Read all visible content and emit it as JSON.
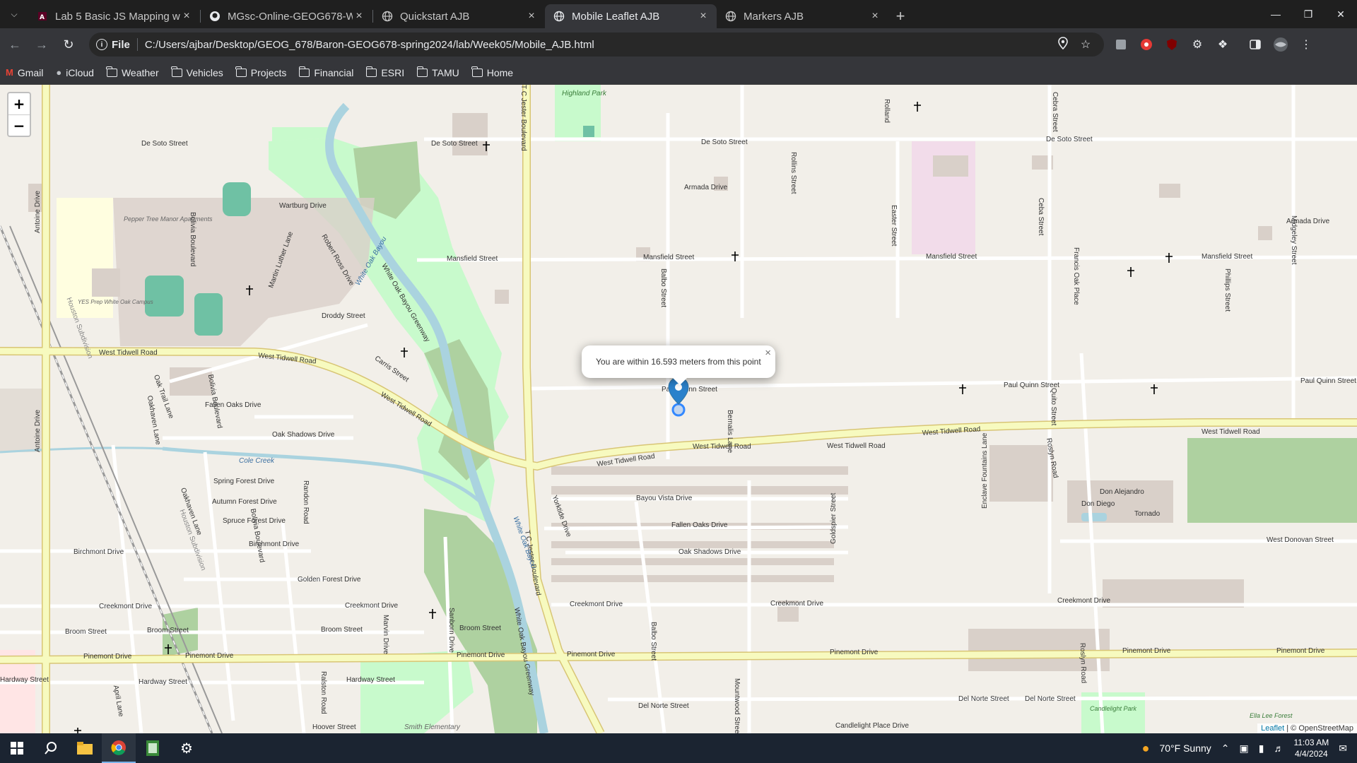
{
  "browser": {
    "tabs": [
      {
        "title": "Lab 5 Basic JS Mapping wi",
        "icon": "tamu-icon",
        "active": false
      },
      {
        "title": "MGsc-Online-GEOG678-W",
        "icon": "github-icon",
        "active": false
      },
      {
        "title": "Quickstart AJB",
        "icon": "globe-icon",
        "active": false
      },
      {
        "title": "Mobile Leaflet AJB",
        "icon": "globe-icon",
        "active": true
      },
      {
        "title": "Markers AJB",
        "icon": "globe-icon",
        "active": false
      }
    ],
    "address": {
      "scheme_label": "File",
      "url": "C:/Users/ajbar/Desktop/GEOG_678/Baron-GEOG678-spring2024/lab/Week05/Mobile_AJB.html"
    },
    "bookmarks": [
      {
        "label": "Gmail",
        "icon": "gmail-icon"
      },
      {
        "label": "iCloud",
        "icon": "apple-icon"
      },
      {
        "label": "Weather",
        "icon": "folder-icon"
      },
      {
        "label": "Vehicles",
        "icon": "folder-icon"
      },
      {
        "label": "Projects",
        "icon": "folder-icon"
      },
      {
        "label": "Financial",
        "icon": "folder-icon"
      },
      {
        "label": "ESRI",
        "icon": "folder-icon"
      },
      {
        "label": "TAMU",
        "icon": "folder-icon"
      },
      {
        "label": "Home",
        "icon": "folder-icon"
      }
    ]
  },
  "map": {
    "zoom_in": "+",
    "zoom_out": "−",
    "popup_text": "You are within 16.593 meters from this point",
    "popup_close": "×",
    "attribution_leaflet": "Leaflet",
    "attribution_osm": "| © OpenStreetMap",
    "labels": {
      "de_soto": "De Soto Street",
      "mansfield": "Mansfield Street",
      "wartburg": "Wartburg Drive",
      "armada": "Armada Drive",
      "highland_park": "Highland Park",
      "pepper_tree": "Pepper Tree Manor Apartments",
      "yes_prep": "YES Prep White Oak Campus",
      "white_oak_bayou": "White Oak Bayou",
      "droddy": "Droddy Street",
      "west_tidwell": "West Tidwell Road",
      "paul_quinn": "Paul Quinn Street",
      "fallen_oaks": "Fallen Oaks Drive",
      "oak_shadows": "Oak Shadows Drive",
      "bayou_vista": "Bayou Vista Drive",
      "cole_creek": "Cole Creek",
      "spring_forest": "Spring Forest Drive",
      "autumn_forest": "Autumn Forest Drive",
      "spruce_forest": "Spruce Forest Drive",
      "birchmont": "Birchmont Drive",
      "golden_forest": "Golden Forest Drive",
      "creekmont": "Creekmont Drive",
      "broom": "Broom Street",
      "pinemont": "Pinemont Drive",
      "hardway": "Hardway Street",
      "hoover": "Hoover Street",
      "smith_elementary": "Smith Elementary",
      "del_norte": "Del Norte Street",
      "candlelight_place": "Candlelight Place Drive",
      "candlelight_park": "Candlelight Park",
      "ella_lee": "Ella Lee Forest",
      "west_donovan": "West Donovan Street",
      "don_alejandro": "Don Alejandro",
      "don_diego": "Don Diego",
      "tornado": "Tornado",
      "tc_jester": "T C Jester Boulevard",
      "antoine": "Antoine Drive",
      "balbo": "Balbo Street",
      "roslyn": "Roslyn Road",
      "rollins": "Rollins Street",
      "ceba": "Ceba Street",
      "francis_oak": "Francis Oak Place",
      "quito": "Quito Street",
      "easter": "Easter Street",
      "gessner": "Goldspier Street",
      "enclave": "Enclave Fountains Lane",
      "midgeley": "Midgeley Street",
      "phillips": "Phillips Street",
      "bernalis": "Bernalis Lane",
      "yorktide": "Yorktide Drive",
      "randon": "Randon Road",
      "ralston": "Ralston Road",
      "sanborn": "Sanborn Drive",
      "mountwood": "Mountwood Street",
      "cebra": "Cebra Street",
      "rolland": "Rolland",
      "bolivia": "Bolivia Boulevard",
      "oak_trail": "Oak Trail Lane",
      "oakhaven": "Oakhaven Lane",
      "martin_luther": "Martin Luther Lane",
      "robert_ross": "Robert Ross Drive",
      "white_oak_greenway": "White Oak Bayou Greenway",
      "carris": "Carris Street",
      "houston_sub": "Houston Subdivision",
      "april": "April Lane",
      "marvin": "Marvin Drive"
    }
  },
  "taskbar": {
    "apps": [
      "windows-start-icon",
      "search-icon",
      "file-explorer-icon",
      "chrome-icon",
      "notepad-icon",
      "settings-icon"
    ],
    "weather": "70°F  Sunny",
    "time": "11:03 AM",
    "date": "4/4/2024"
  }
}
